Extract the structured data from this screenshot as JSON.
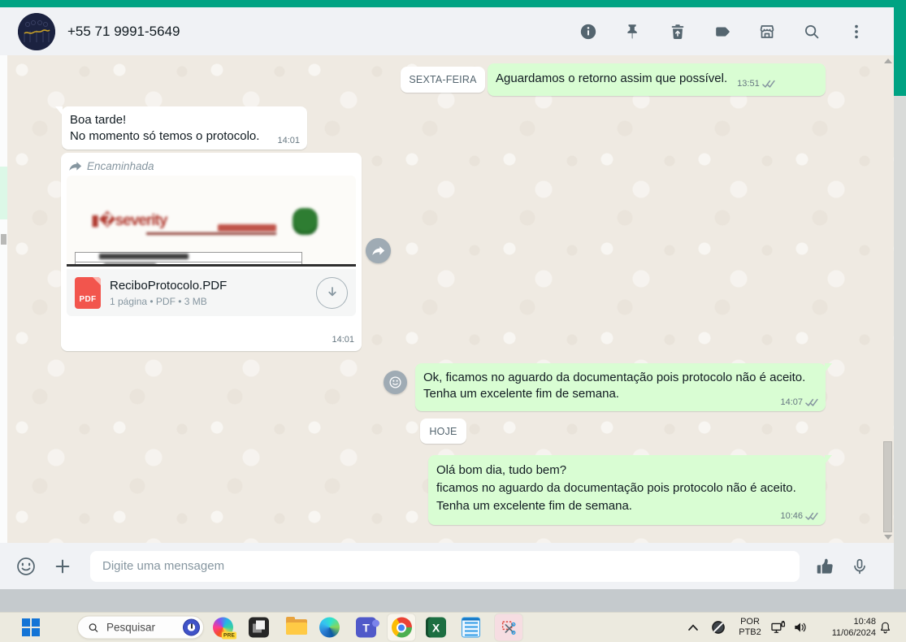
{
  "colors": {
    "whatsapp_green": "#00a383",
    "bubble_out": "#d9fdd3",
    "pdf_red": "#f2554d"
  },
  "header": {
    "phone": "+55 71 9991-5649"
  },
  "chat": {
    "badge_friday": "SEXTA-FEIRA",
    "badge_today": "HOJE",
    "m1": {
      "text": "Aguardamos o retorno assim que possível.",
      "time": "13:51"
    },
    "m2": {
      "line1": "Boa tarde!",
      "line2": "No momento só temos o protocolo.",
      "time": "14:01"
    },
    "doc": {
      "forwarded_label": "Encaminhada",
      "filename": "ReciboProtocolo.PDF",
      "file_meta": "1 página • PDF • 3 MB",
      "pdf_badge": "PDF",
      "time": "14:01"
    },
    "m4": {
      "line1": "Ok, ficamos no aguardo da documentação pois protocolo não é aceito.",
      "line2": "Tenha um excelente fim de semana.",
      "time": "14:07"
    },
    "m5": {
      "line1": "Olá bom dia, tudo bem?",
      "line2": "ficamos no aguardo da documentação pois protocolo não é aceito.",
      "line3": "Tenha um excelente fim de semana.",
      "time": "10:46"
    }
  },
  "composer": {
    "placeholder": "Digite uma mensagem"
  },
  "taskbar": {
    "search_placeholder": "Pesquisar",
    "copilot_badge": "PRE",
    "teams_letter": "T",
    "excel_letter": "X",
    "lang_top": "POR",
    "lang_bottom": "PTB2",
    "clock_time": "10:48",
    "clock_date": "11/06/2024"
  }
}
